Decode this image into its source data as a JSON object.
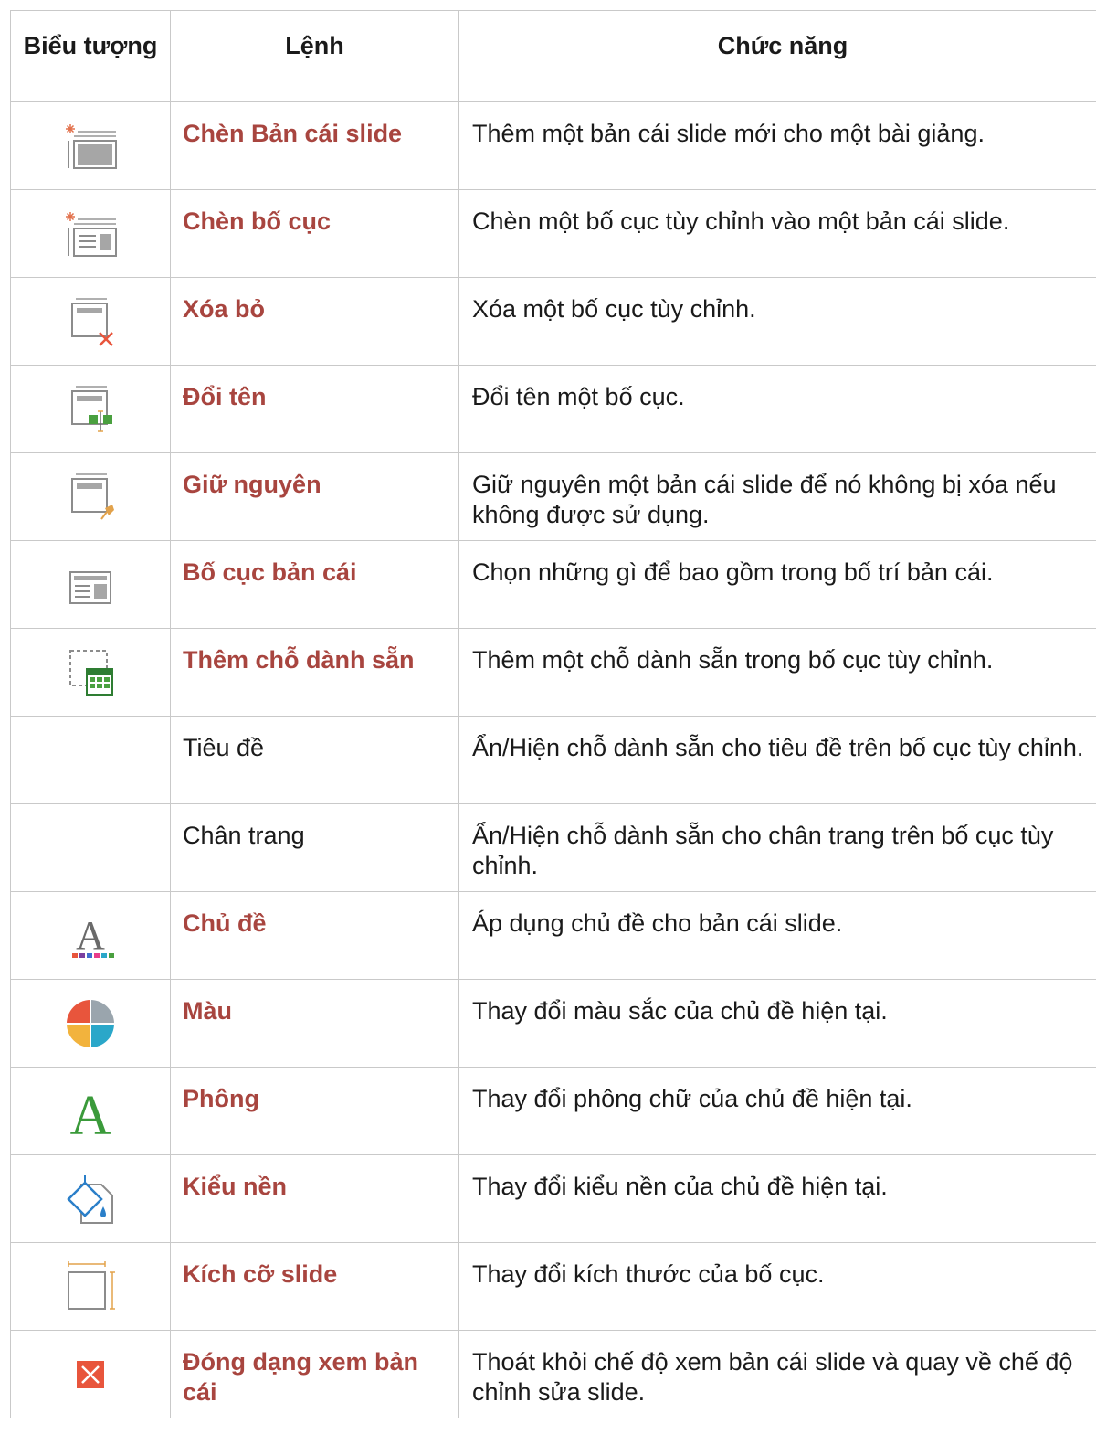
{
  "header": {
    "icon": "Biểu tượng",
    "command": "Lệnh",
    "function": "Chức năng"
  },
  "rows": [
    {
      "icon": "insert-slide-master-icon",
      "command": "Chèn Bản cái slide",
      "bold": true,
      "function": "Thêm một bản cái slide mới cho một bài giảng."
    },
    {
      "icon": "insert-layout-icon",
      "command": "Chèn bố cục",
      "bold": true,
      "function": "Chèn một bố cục tùy chỉnh vào một bản cái slide."
    },
    {
      "icon": "delete-layout-icon",
      "command": "Xóa bỏ",
      "bold": true,
      "function": "Xóa một bố cục tùy chỉnh."
    },
    {
      "icon": "rename-layout-icon",
      "command": "Đổi tên",
      "bold": true,
      "function": "Đổi tên một bố cục."
    },
    {
      "icon": "preserve-pin-icon",
      "command": "Giữ nguyên",
      "bold": true,
      "function": "Giữ nguyên một bản cái slide để nó không bị xóa nếu không được sử dụng."
    },
    {
      "icon": "master-layout-icon",
      "command": "Bố cục bản cái",
      "bold": true,
      "function": "Chọn những gì để bao gồm trong bố trí bản cái."
    },
    {
      "icon": "insert-placeholder-icon",
      "command": "Thêm chỗ dành sẵn",
      "bold": true,
      "function": "Thêm một chỗ dành sẵn trong bố cục tùy chỉnh."
    },
    {
      "icon": "",
      "command": "Tiêu đề",
      "bold": false,
      "function": "Ẩn/Hiện chỗ dành sẵn cho tiêu đề trên bố cục tùy chỉnh."
    },
    {
      "icon": "",
      "command": "Chân trang",
      "bold": false,
      "function": "Ẩn/Hiện chỗ dành sẵn cho chân trang trên bố cục tùy chỉnh."
    },
    {
      "icon": "themes-icon",
      "command": "Chủ đề",
      "bold": true,
      "function": "Áp dụng chủ đề cho bản cái slide."
    },
    {
      "icon": "colors-icon",
      "command": "Màu",
      "bold": true,
      "function": "Thay đổi màu sắc của chủ đề hiện tại."
    },
    {
      "icon": "fonts-icon",
      "command": "Phông",
      "bold": true,
      "function": "Thay đổi phông chữ của chủ đề hiện tại."
    },
    {
      "icon": "background-styles-icon",
      "command": "Kiểu nền",
      "bold": true,
      "function": "Thay đổi kiểu nền của chủ đề hiện tại."
    },
    {
      "icon": "slide-size-icon",
      "command": "Kích cỡ slide",
      "bold": true,
      "function": "Thay đổi kích thước của bố cục."
    },
    {
      "icon": "close-master-view-icon",
      "command": "Đóng dạng xem bản cái",
      "bold": true,
      "function": "Thoát khỏi chế độ xem bản cái slide và quay về chế độ chỉnh sửa slide."
    }
  ],
  "colors": {
    "command_text": "#a8453f",
    "border": "#c9c9c9",
    "icon_gray": "#8c8c8c",
    "close_red": "#e8553c"
  }
}
